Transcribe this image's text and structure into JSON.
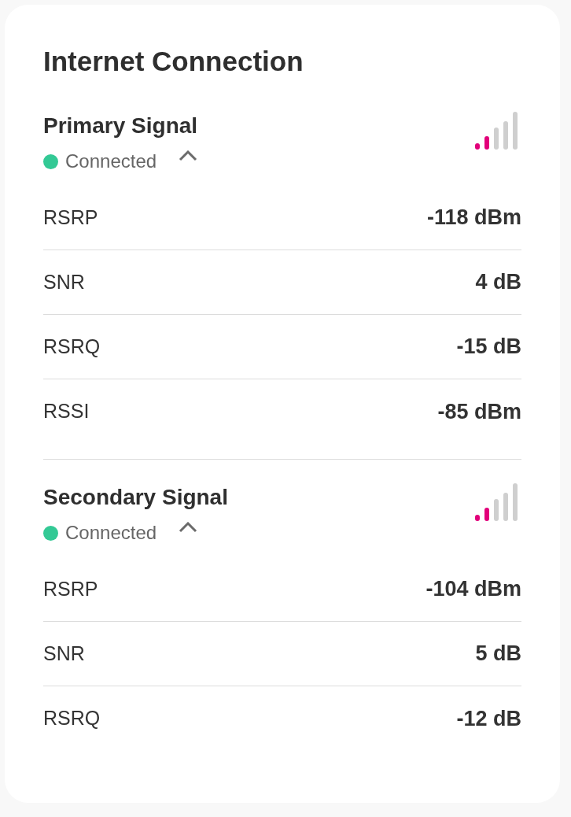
{
  "card": {
    "title": "Internet Connection"
  },
  "signals": [
    {
      "title": "Primary Signal",
      "status": "Connected",
      "expanded": true,
      "metrics": [
        {
          "label": "RSRP",
          "value": "-118 dBm"
        },
        {
          "label": "SNR",
          "value": "4 dB"
        },
        {
          "label": "RSRQ",
          "value": "-15 dB"
        },
        {
          "label": "RSSI",
          "value": "-85 dBm"
        }
      ]
    },
    {
      "title": "Secondary Signal",
      "status": "Connected",
      "expanded": true,
      "metrics": [
        {
          "label": "RSRP",
          "value": "-104 dBm"
        },
        {
          "label": "SNR",
          "value": "5 dB"
        },
        {
          "label": "RSRQ",
          "value": "-12 dB"
        }
      ]
    }
  ]
}
